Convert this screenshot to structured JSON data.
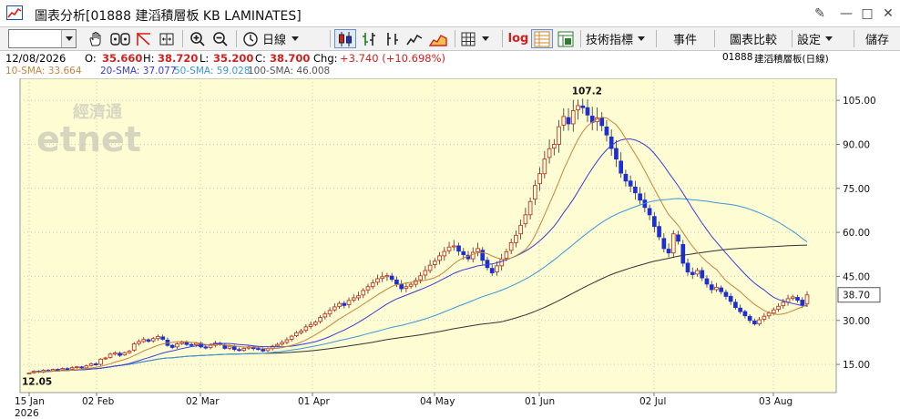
{
  "window": {
    "title": "圖表分析[01888 建滔積層板 KB LAMINATES]",
    "buttons": [
      "✎",
      "—",
      "□",
      "✕"
    ]
  },
  "toolbar": {
    "stock_code_value": "",
    "period_label": "日線",
    "log_label": "log",
    "indicators_label": "技術指標",
    "events_label": "事件",
    "compare_label": "圖表比較",
    "settings_label": "設定",
    "save_label": "儲存"
  },
  "quote": {
    "date": "12/08/2026",
    "open_label": "O:",
    "open": "35.660",
    "high_label": "H:",
    "high": "38.720",
    "low_label": "L:",
    "low": "35.200",
    "close_label": "C:",
    "close": "38.700",
    "chg_label": "Chg:",
    "chg": "+3.740 (+10.698%)",
    "code": "01888",
    "name": "建滔積層板(日線)"
  },
  "sma": [
    {
      "label": "10-SMA:",
      "value": "33.664",
      "color": "#c8843c"
    },
    {
      "label": "20-SMA:",
      "value": "37.077",
      "color": "#3a3adc"
    },
    {
      "label": "50-SMA:",
      "value": "59.028",
      "color": "#3c96dc"
    },
    {
      "label": "100-SMA:",
      "value": "46.008",
      "color": "#555555"
    }
  ],
  "watermark": {
    "chinese": "經濟通",
    "latin": "etnet"
  },
  "colors": {
    "plot_bg": "#fdfcd2",
    "up": "#c0392b",
    "down": "#1c2fd6",
    "sma10": "#c8843c",
    "sma20": "#3a3adc",
    "sma50": "#3c96dc",
    "sma100": "#333333",
    "positive": "#d4201c"
  },
  "chart_data": {
    "type": "candlestick",
    "y_ticks": [
      15.0,
      30.0,
      45.0,
      60.0,
      75.0,
      90.0,
      105.0
    ],
    "y_tick_labels": [
      "15.00",
      "30.00",
      "45.00",
      "60.00",
      "75.00",
      "90.00",
      "105.00"
    ],
    "ylim": [
      5.4,
      112.5
    ],
    "x_labels": [
      {
        "date": "2026-01-15",
        "label": "15 Jan",
        "sub": "2026"
      },
      {
        "date": "2026-02-02",
        "label": "02 Feb",
        "sub": ""
      },
      {
        "date": "2026-03-02",
        "label": "02 Mar",
        "sub": ""
      },
      {
        "date": "2026-04-01",
        "label": "01 Apr",
        "sub": ""
      },
      {
        "date": "2026-05-04",
        "label": "04 May",
        "sub": ""
      },
      {
        "date": "2026-06-01",
        "label": "01 Jun",
        "sub": ""
      },
      {
        "date": "2026-07-02",
        "label": "02 Jul",
        "sub": ""
      },
      {
        "date": "2026-08-03",
        "label": "03 Aug",
        "sub": ""
      }
    ],
    "last_price_label": "38.70",
    "last_price": 38.7,
    "max_label": "107.2",
    "min_label": "12.05",
    "closes": [
      12.05,
      12.7,
      12.4,
      13.0,
      12.8,
      13.3,
      13.1,
      13.6,
      13.4,
      13.9,
      14.2,
      13.8,
      14.5,
      15.2,
      15.0,
      16.8,
      17.2,
      18.5,
      18.9,
      18.1,
      19.0,
      19.5,
      22.0,
      22.8,
      23.5,
      22.9,
      23.8,
      24.5,
      23.6,
      21.5,
      20.8,
      22.0,
      22.5,
      21.8,
      21.6,
      22.2,
      21.0,
      20.6,
      21.5,
      22.3,
      21.8,
      20.5,
      21.2,
      20.1,
      19.8,
      20.5,
      21.0,
      20.4,
      20.2,
      19.6,
      20.4,
      21.2,
      21.8,
      22.5,
      23.4,
      24.6,
      25.8,
      26.4,
      27.8,
      28.6,
      29.4,
      31.0,
      32.2,
      33.4,
      34.6,
      35.8,
      35.1,
      36.8,
      37.7,
      38.4,
      40.2,
      41.5,
      42.8,
      44.2,
      44.9,
      45.3,
      44.0,
      42.4,
      40.8,
      41.5,
      42.3,
      43.6,
      45.2,
      47.0,
      48.8,
      50.2,
      52.0,
      53.5,
      55.0,
      55.4,
      53.6,
      52.4,
      51.0,
      53.2,
      54.5,
      50.5,
      48.0,
      46.2,
      48.6,
      50.8,
      53.4,
      56.5,
      59.0,
      62.4,
      66.0,
      70.5,
      76.0,
      80.0,
      85.0,
      88.5,
      90.0,
      96.0,
      99.5,
      97.0,
      101.5,
      103.2,
      102.5,
      100.0,
      97.5,
      99.0,
      96.4,
      93.2,
      88.6,
      85.0,
      80.2,
      77.5,
      75.8,
      73.5,
      71.0,
      68.5,
      66.0,
      62.0,
      58.5,
      54.5,
      53.0,
      59.5,
      57.0,
      49.5,
      46.5,
      45.6,
      47.0,
      44.5,
      42.4,
      40.5,
      41.3,
      39.8,
      38.2,
      36.5,
      34.4,
      33.0,
      31.6,
      30.0,
      28.8,
      30.2,
      31.4,
      32.5,
      33.6,
      34.8,
      36.2,
      37.4,
      38.0,
      36.9,
      35.2,
      38.7
    ],
    "series": [
      {
        "name": "10-SMA",
        "value": 33.664
      },
      {
        "name": "20-SMA",
        "value": 37.077
      },
      {
        "name": "50-SMA",
        "value": 59.028
      },
      {
        "name": "100-SMA",
        "value": 46.008
      }
    ]
  }
}
